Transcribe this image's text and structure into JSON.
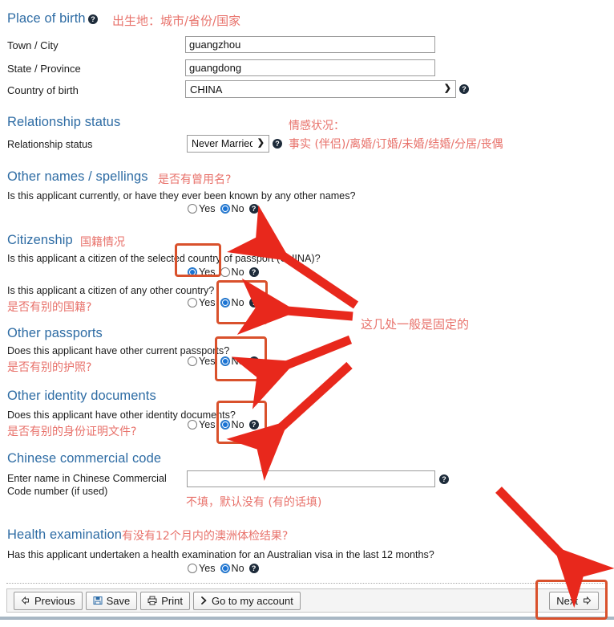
{
  "colors": {
    "heading": "#2e6ca4",
    "annotation": "#e8726b",
    "highlight_box": "#d9512c",
    "arrow": "#e8281c",
    "radio_selected": "#1a73d4"
  },
  "sections": {
    "place_of_birth": {
      "heading": "Place of birth",
      "annotation": "出生地：城市/省份/国家",
      "fields": [
        {
          "label": "Town / City",
          "value": "guangzhou",
          "placeholder": ""
        },
        {
          "label": "State / Province",
          "value": "guangdong",
          "placeholder": ""
        }
      ],
      "country": {
        "label": "Country of birth",
        "value": "CHINA",
        "options": [
          "CHINA"
        ]
      }
    },
    "relationship_status": {
      "heading": "Relationship status",
      "label": "Relationship status",
      "value": "Never Married",
      "options": [
        "Never Married"
      ],
      "annotation_line1": "情感状况：",
      "annotation_line2": "事实 (伴侣)/离婚/订婚/未婚/结婚/分居/丧偶"
    },
    "other_names": {
      "heading": "Other names / spellings",
      "annotation": "是否有曾用名?",
      "question": "Is this applicant currently, or have they ever been known by any other names?",
      "yes_label": "Yes",
      "no_label": "No",
      "selected": "No"
    },
    "citizenship": {
      "heading": "Citizenship",
      "annotation": "国籍情况",
      "q1": {
        "question": "Is this applicant a citizen of the selected country of passport (CHINA)?",
        "yes_label": "Yes",
        "no_label": "No",
        "selected": "Yes"
      },
      "q2": {
        "question": "Is this applicant a citizen of any other country?",
        "annotation": "是否有别的国籍?",
        "yes_label": "Yes",
        "no_label": "No",
        "selected": "No"
      }
    },
    "other_passports": {
      "heading": "Other passports",
      "question": "Does this applicant have other current passports?",
      "annotation": "是否有别的护照?",
      "yes_label": "Yes",
      "no_label": "No",
      "selected": "No"
    },
    "other_identity_documents": {
      "heading": "Other identity documents",
      "question": "Does this applicant have other identity documents?",
      "annotation": "是否有别的身份证明文件?",
      "yes_label": "Yes",
      "no_label": "No",
      "selected": "No"
    },
    "chinese_commercial_code": {
      "heading": "Chinese commercial code",
      "label": "Enter name in Chinese Commercial Code number (if used)",
      "value": "",
      "placeholder": "",
      "annotation": "不填，默认没有 (有的话填)"
    },
    "health_examination": {
      "heading": "Health examination",
      "annotation": "有没有12个月内的澳洲体检结果?",
      "question": "Has this applicant undertaken a health examination for an Australian visa in the last 12 months?",
      "yes_label": "Yes",
      "no_label": "No",
      "selected": "No"
    }
  },
  "right_annotation": "这几处一般是固定的",
  "toolbar": {
    "previous_label": "Previous",
    "save_label": "Save",
    "print_label": "Print",
    "account_label": "Go to my account",
    "next_label": "Next"
  },
  "icons": {
    "help": "?",
    "previous": "left-arrow-icon",
    "save": "floppy-disk-icon",
    "print": "printer-icon",
    "account": "chevron-right-icon",
    "next": "right-arrow-icon",
    "dropdown": "chevron-down-icon"
  }
}
